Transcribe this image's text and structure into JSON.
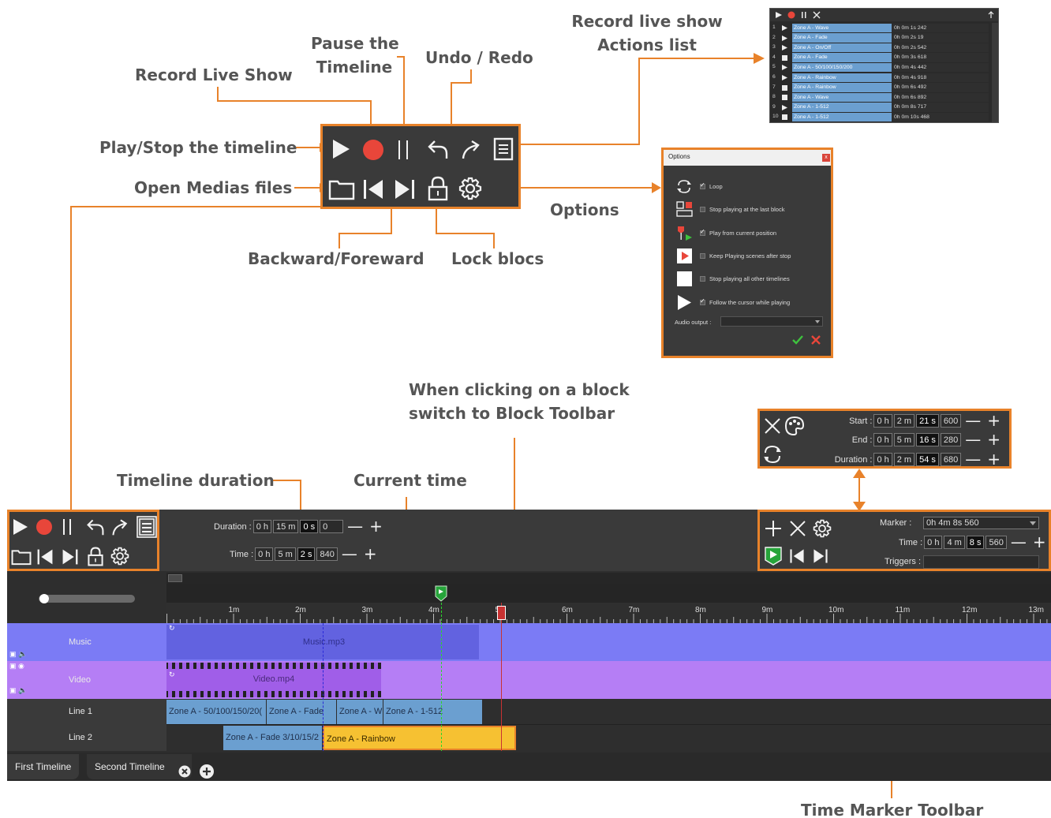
{
  "callouts": {
    "record_live_show": "Record Live Show",
    "pause_line1": "Pause the",
    "pause_line2": "Timeline",
    "undo_redo": "Undo / Redo",
    "actions_line1": "Record live show",
    "actions_line2": "Actions list",
    "play_stop": "Play/Stop the timeline",
    "open_medias": "Open Medias files",
    "options": "Options",
    "backward_foreward": "Backward/Foreward",
    "lock_blocs": "Lock blocs",
    "block_click_line1": "When clicking on a block",
    "block_click_line2": "switch to Block Toolbar",
    "timeline_duration": "Timeline duration",
    "current_time": "Current time",
    "time_marker_toolbar": "Time Marker Toolbar"
  },
  "colors": {
    "accent": "#e8822a",
    "record_red": "#e8463a",
    "music_track": "#7b7bf5",
    "music_block": "#6262e0",
    "video_track": "#b57ef5",
    "video_block": "#a05ee8",
    "line_block_blue": "#6b9fd0",
    "line_block_yellow": "#f6c132",
    "marker_green": "#26a43a"
  },
  "actions_list": {
    "rows": [
      {
        "n": "1",
        "icon": "play",
        "name": "Zone A - Wave",
        "time": "0h 0m 1s 242"
      },
      {
        "n": "2",
        "icon": "play",
        "name": "Zone A - Fade",
        "time": "0h 0m 2s 19"
      },
      {
        "n": "3",
        "icon": "play",
        "name": "Zone A - On/Off",
        "time": "0h 0m 2s 542"
      },
      {
        "n": "4",
        "icon": "stop",
        "name": "Zone A - Fade",
        "time": "0h 0m 3s 618"
      },
      {
        "n": "5",
        "icon": "play",
        "name": "Zone A - 50/100/150/200",
        "time": "0h 0m 4s 442"
      },
      {
        "n": "6",
        "icon": "play",
        "name": "Zone A - Rainbow",
        "time": "0h 0m 4s 918"
      },
      {
        "n": "7",
        "icon": "stop",
        "name": "Zone A - Rainbow",
        "time": "0h 0m 6s 492"
      },
      {
        "n": "8",
        "icon": "stop",
        "name": "Zone A - Wave",
        "time": "0h 0m 6s 892"
      },
      {
        "n": "9",
        "icon": "play",
        "name": "Zone A - 1-512",
        "time": "0h 0m 8s 717"
      },
      {
        "n": "10",
        "icon": "stop",
        "name": "Zone A - 1-512",
        "time": "0h 0m 10s 468"
      }
    ]
  },
  "options_dialog": {
    "title": "Options",
    "close": "x",
    "items": [
      {
        "icon": "loop-icon",
        "checked": true,
        "label": "Loop"
      },
      {
        "icon": "last-block-icon",
        "checked": false,
        "label": "Stop playing at the last block"
      },
      {
        "icon": "play-from-position-icon",
        "checked": true,
        "label": "Play from current position"
      },
      {
        "icon": "keep-playing-icon",
        "checked": false,
        "label": "Keep Playing scenes after stop"
      },
      {
        "icon": "stop-square-icon",
        "checked": false,
        "label": "Stop playing all other timelines"
      },
      {
        "icon": "play-triangle-icon",
        "checked": true,
        "label": "Follow the cursor while playing"
      }
    ],
    "audio_output_label": "Audio output :",
    "audio_output_value": ""
  },
  "block_toolbar": {
    "start_label": "Start :",
    "start": [
      "0 h",
      "2 m",
      "21 s",
      "600"
    ],
    "end_label": "End :",
    "end": [
      "0 h",
      "5 m",
      "16 s",
      "280"
    ],
    "duration_label": "Duration :",
    "duration": [
      "0 h",
      "2 m",
      "54 s",
      "680"
    ]
  },
  "main_toolbar": {
    "duration_label": "Duration :",
    "duration": [
      "0 h",
      "15 m",
      "0 s",
      "0"
    ],
    "time_label": "Time :",
    "time": [
      "0 h",
      "5 m",
      "2 s",
      "840"
    ]
  },
  "marker_toolbar": {
    "marker_label": "Marker :",
    "marker_value": "0h 4m 8s 560",
    "time_label": "Time :",
    "time": [
      "0 h",
      "4 m",
      "8 s",
      "560"
    ],
    "triggers_label": "Triggers :",
    "triggers_value": ""
  },
  "plus": "+",
  "minus": "—",
  "ruler": {
    "ticks": [
      "1m",
      "2m",
      "3m",
      "4m",
      "5m",
      "6m",
      "7m",
      "8m",
      "9m",
      "10m",
      "11m",
      "12m",
      "13m"
    ]
  },
  "tracks": {
    "music": {
      "label": "Music",
      "block": "Music.mp3"
    },
    "video": {
      "label": "Video",
      "block": "Video.mp4"
    },
    "line1": {
      "label": "Line 1",
      "blocks": [
        "Zone A - 50/100/150/20(",
        "Zone A - Fade",
        "Zone A - W",
        "Zone A - 1-512"
      ]
    },
    "line2": {
      "label": "Line 2",
      "blocks": [
        "Zone A - Fade 3/10/15/2",
        "Zone A - Rainbow"
      ]
    }
  },
  "tabs": {
    "first": "First Timeline",
    "second": "Second Timeline"
  },
  "icons": {
    "add-tab": "plus-circle-icon",
    "close-tab": "close-circle-icon"
  }
}
